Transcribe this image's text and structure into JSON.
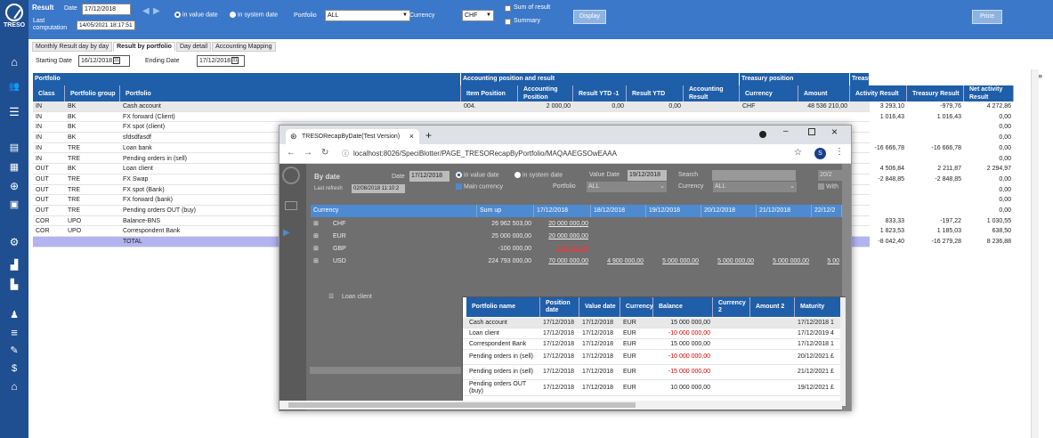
{
  "app": {
    "logo_text": "TRESO"
  },
  "topbar": {
    "result_label": "Result",
    "date_label": "Date",
    "date_value": "17/12/2018",
    "last_label": "Last",
    "computation_label": "computation",
    "last_computation_value": "14/05/2021 18:17:51",
    "radio_value_date": "in value date",
    "radio_system_date": "in system date",
    "portfolio_label": "Portfolio",
    "portfolio_value": "ALL",
    "currency_label": "Currency",
    "currency_value": "CHF",
    "sum_of_result": "Sum of result",
    "summary": "Summary",
    "display_button": "Display",
    "price_button": "Price"
  },
  "tabs": [
    "Monthly Result day by day",
    "Result by portfolio",
    "Day detail",
    "Accounting Mapping"
  ],
  "active_tab": 1,
  "filters": {
    "starting_label": "Starting Date",
    "starting_value": "16/12/2018",
    "ending_label": "Ending Date",
    "ending_value": "17/12/2018"
  },
  "grid": {
    "groups": [
      "Portfolio",
      "Accounting position and result",
      "Treasury position",
      "Treasury result"
    ],
    "columns": [
      "Class",
      "Portfolio group",
      "Portfolio",
      "Item Position",
      "Accounting Position",
      "Result YTD -1",
      "Result YTD",
      "Accounting Result",
      "Currency",
      "Amount",
      "Activity Result",
      "Treasury Result",
      "Net activity Result"
    ],
    "rows": [
      [
        "IN",
        "BK",
        "Cash account",
        "004.",
        "2 000,00",
        "0,00",
        "0,00",
        "",
        "CHF",
        "48 536 210,00",
        "3 293,10",
        "-979,76",
        "4 272,86"
      ],
      [
        "IN",
        "BK",
        "FX forward (Client)",
        "",
        "",
        "",
        "",
        "",
        "",
        "",
        "1 016,43",
        "1 016,43",
        "0,00"
      ],
      [
        "IN",
        "BK",
        "FX spot (client)",
        "",
        "",
        "",
        "",
        "",
        "",
        "",
        "",
        "",
        "0,00"
      ],
      [
        "IN",
        "BK",
        "sfdsdfasdf",
        "",
        "",
        "",
        "",
        "",
        "",
        "",
        "",
        "",
        "0,00"
      ],
      [
        "IN",
        "TRE",
        "Loan bank",
        "",
        "",
        "",
        "",
        "",
        "",
        "",
        "-16 666,78",
        "-16 666,78",
        "0,00"
      ],
      [
        "IN",
        "TRE",
        "Pending orders in (sell)",
        "",
        "",
        "",
        "",
        "",
        "",
        "",
        "",
        "",
        "0,00"
      ],
      [
        "OUT",
        "BK",
        "Loan client",
        "",
        "",
        "",
        "",
        "",
        "",
        "",
        "4 506,84",
        "2 211,87",
        "2 294,97"
      ],
      [
        "OUT",
        "TRE",
        "FX Swap",
        "",
        "",
        "",
        "",
        "",
        "",
        "",
        "-2 848,85",
        "-2 848,85",
        "0,00"
      ],
      [
        "OUT",
        "TRE",
        "FX spot (Bank)",
        "",
        "",
        "",
        "",
        "",
        "",
        "",
        "",
        "",
        "0,00"
      ],
      [
        "OUT",
        "TRE",
        "FX forward (bank)",
        "",
        "",
        "",
        "",
        "",
        "",
        "",
        "",
        "",
        "0,00"
      ],
      [
        "OUT",
        "TRE",
        "Pending orders OUT (buy)",
        "",
        "",
        "",
        "",
        "",
        "",
        "",
        "",
        "",
        "0,00"
      ],
      [
        "COR",
        "UPO",
        "Balance-BNS",
        "",
        "",
        "",
        "",
        "",
        "",
        "",
        "833,33",
        "-197,22",
        "1 030,55"
      ],
      [
        "COR",
        "UPO",
        "Correspondent Bank",
        "",
        "",
        "",
        "",
        "",
        "",
        "",
        "1 823,53",
        "1 185,03",
        "638,50"
      ],
      [
        "",
        "",
        "TOTAL",
        "",
        "",
        "",
        "",
        "",
        "",
        "",
        "-8 042,40",
        "-16 279,28",
        "8 236,88"
      ]
    ]
  },
  "browser": {
    "tab_title": "TRESORecapByDate(Test Version)",
    "url": "localhost:8026/SpeciBlotter/PAGE_TRESORecapByPortfolio/MAQAAEGSOwEAAA",
    "avatar": "S",
    "inner": {
      "by_date": "By date",
      "date_label": "Date",
      "date_value": "17/12/2018",
      "last_refresh_label": "Last refresh",
      "last_refresh_value": "02/08/2018 11:10:2",
      "in_value_date": "in value date",
      "in_system_date": "in system date",
      "main_currency": "Main currency",
      "value_date_label": "Value Date",
      "value_date_value": "19/12/2018",
      "search_label": "Search",
      "portfolio_label": "Portfolio",
      "portfolio_value": "ALL",
      "currency_label": "Currency",
      "currency_value": "ALL",
      "with_label": "With",
      "corner_value": "20/2",
      "headers": [
        "Currency",
        "Sum up",
        "17/12/2018",
        "18/12/2018",
        "19/12/2018",
        "20/12/2018",
        "21/12/2018",
        "22/12/2"
      ],
      "rows": [
        {
          "cur": "CHF",
          "sum": "26 962 503,00",
          "v": [
            "20 000 000,00",
            "",
            "",
            "",
            "",
            ""
          ]
        },
        {
          "cur": "EUR",
          "sum": "25 000 000,00",
          "v": [
            "20 000 000,00",
            "",
            "",
            "",
            "",
            ""
          ]
        },
        {
          "cur": "GBP",
          "sum": "-100 000,00",
          "v": [
            "-100 000,00",
            "",
            "",
            "",
            "",
            ""
          ]
        },
        {
          "cur": "USD",
          "sum": "224 793 000,00",
          "v": [
            "70 000 000,00",
            "4 900 000,00",
            "5 000 000,00",
            "5 000 000,00",
            "5 000 000,00",
            "5 00"
          ]
        }
      ],
      "loan_client": "Loan client"
    },
    "popup": {
      "headers": [
        "Portfolio name",
        "Position date",
        "Value date",
        "Currency",
        "Balance",
        "Currency 2",
        "Amount 2",
        "Maturity"
      ],
      "rows": [
        [
          "Cash account",
          "17/12/2018",
          "17/12/2018",
          "EUR",
          "15 000 000,00",
          "",
          "",
          "17/12/2018 1"
        ],
        [
          "Loan client",
          "17/12/2018",
          "17/12/2018",
          "EUR",
          "-10 000 000,00",
          "",
          "",
          "17/12/2019 4"
        ],
        [
          "Correspondent Bank",
          "17/12/2018",
          "17/12/2018",
          "EUR",
          "15 000 000,00",
          "",
          "",
          "17/12/2018 1"
        ],
        [
          "Pending orders in (sell)",
          "17/12/2018",
          "17/12/2018",
          "EUR",
          "-10 000 000,00",
          "",
          "",
          "20/12/2021 £"
        ],
        [
          "Pending orders in (sell)",
          "17/12/2018",
          "17/12/2018",
          "EUR",
          "-15 000 000,00",
          "",
          "",
          "21/12/2021 £"
        ],
        [
          "Pending orders OUT (buy)",
          "17/12/2018",
          "17/12/2018",
          "EUR",
          "10 000 000,00",
          "",
          "",
          "19/12/2021 £"
        ]
      ]
    }
  }
}
